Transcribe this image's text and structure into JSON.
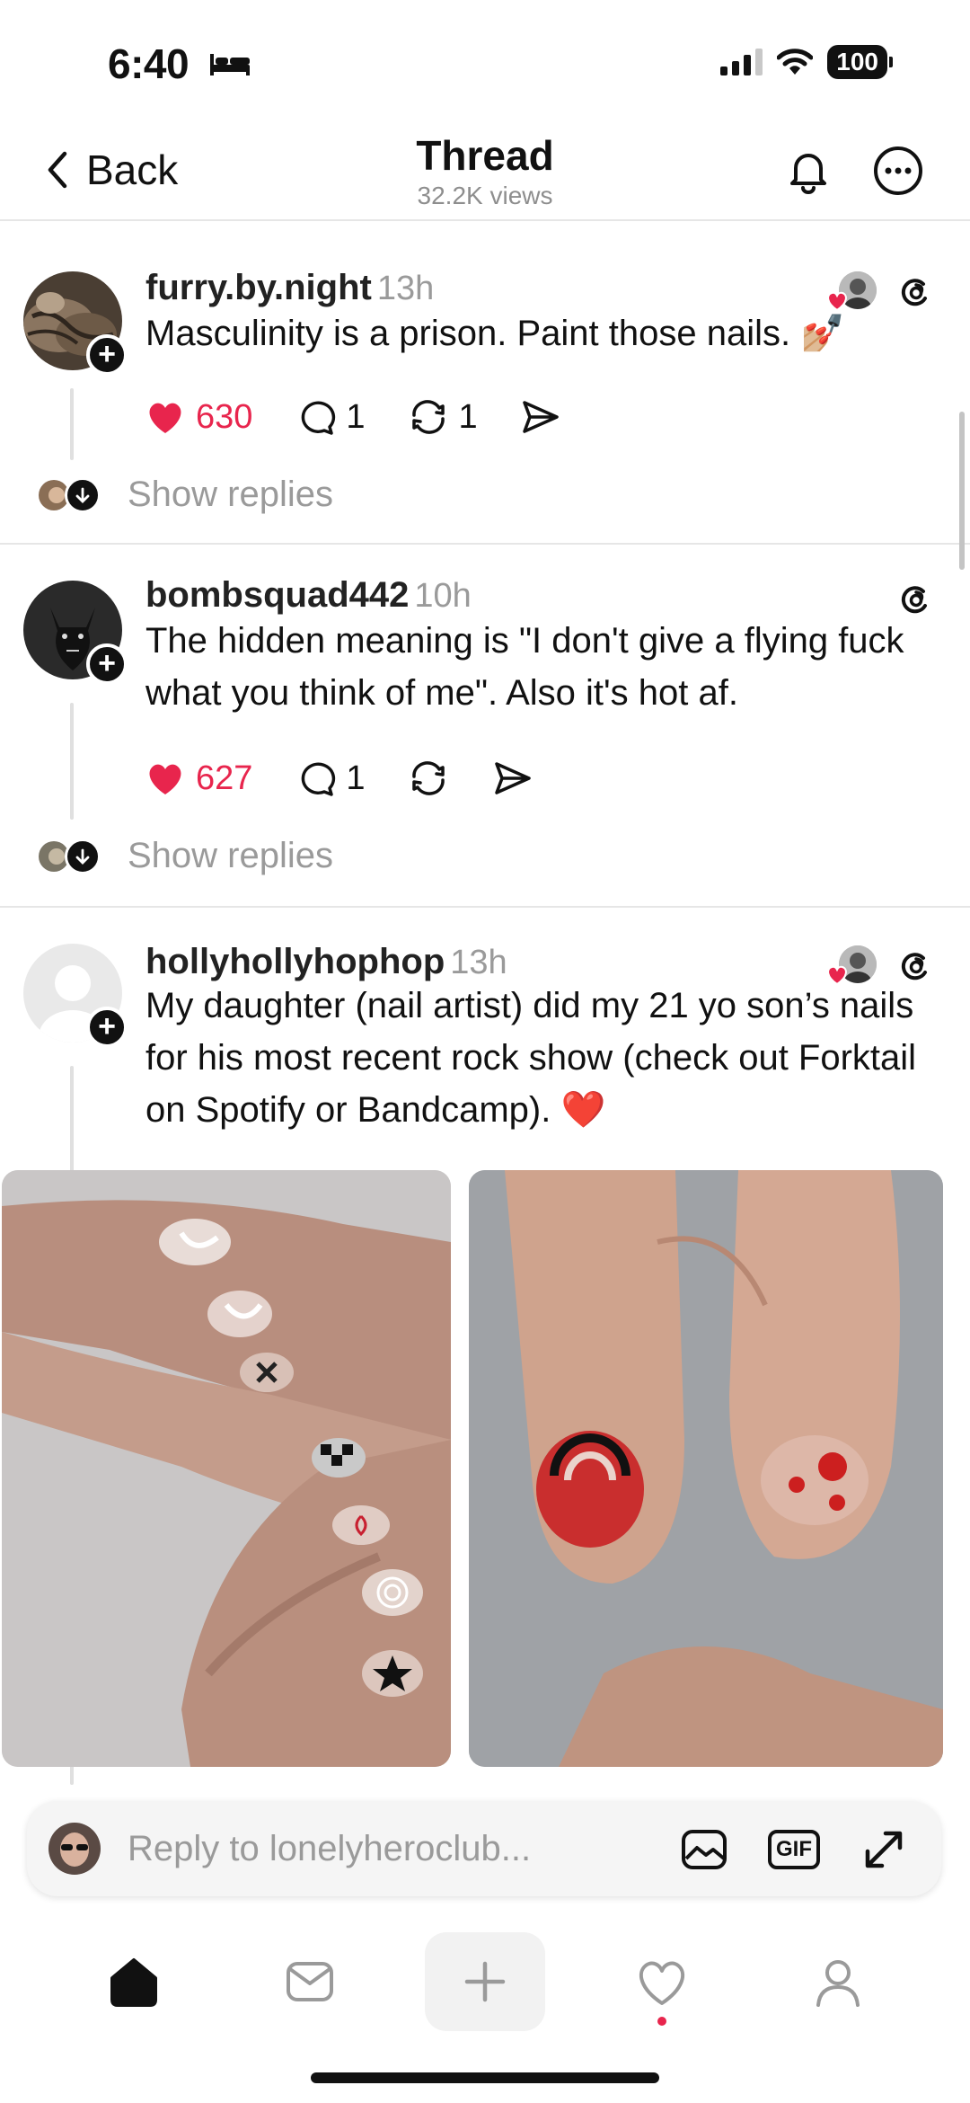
{
  "status_bar": {
    "time": "6:40",
    "battery": "100",
    "icons": [
      "bed-icon",
      "signal-icon",
      "wifi-icon",
      "battery-icon"
    ]
  },
  "header": {
    "back_label": "Back",
    "title": "Thread",
    "views": "32.2K views",
    "icons": [
      "chevron-left-icon",
      "bell-icon",
      "more-icon"
    ]
  },
  "posts": [
    {
      "username": "furry.by.night",
      "time": "13h",
      "text": "Masculinity is a prison. Paint those nails. 💅🏼",
      "likes": "630",
      "replies": "1",
      "reposts": "1",
      "liked": true,
      "show_replies": "Show replies",
      "liked_by_author_badge": true
    },
    {
      "username": "bombsquad442",
      "time": "10h",
      "text": "The hidden meaning is \"I don't give a flying fuck what you think of me\". Also it's hot af.",
      "likes": "627",
      "replies": "1",
      "reposts": "",
      "liked": true,
      "show_replies": "Show replies",
      "liked_by_author_badge": false
    },
    {
      "username": "hollyhollyhophop",
      "time": "13h",
      "text": "My daughter (nail artist) did my 21 yo son’s nails for his most recent rock show (check out Forktail on Spotify or Bandcamp). ❤️",
      "liked_by_author_badge": true,
      "images": [
        "hand-with-painted-nails-photo",
        "fingertips-red-nail-art-photo"
      ]
    }
  ],
  "reply_bar": {
    "placeholder": "Reply to lonelyheroclub...",
    "gif_label": "GIF",
    "icons": [
      "image-icon",
      "gif-icon",
      "expand-icon"
    ]
  },
  "bottom_nav": {
    "items": [
      "home-icon",
      "inbox-icon",
      "create-icon",
      "activity-icon",
      "profile-icon"
    ],
    "active": "home-icon",
    "activity_dot": true
  },
  "colors": {
    "like_red": "#e8254d",
    "text": "#111111",
    "muted": "#9a9a9a",
    "divider": "#e6e6e6"
  }
}
